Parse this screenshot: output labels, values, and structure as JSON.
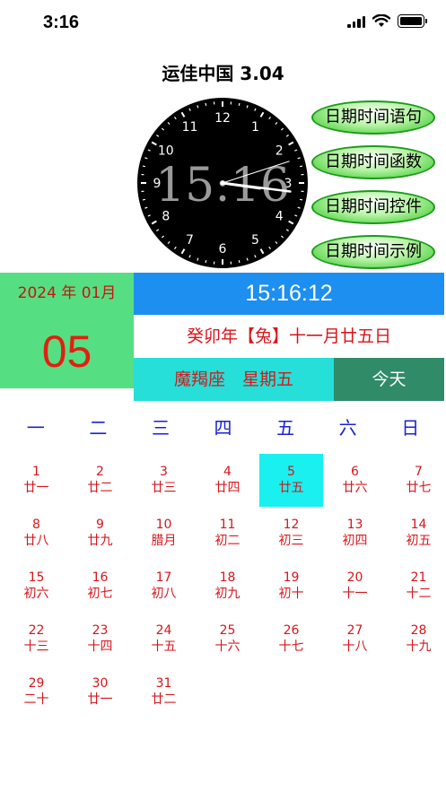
{
  "status_bar": {
    "time": "3:16"
  },
  "app": {
    "title": "运佳中国 3.04"
  },
  "clock": {
    "digital": "15:16",
    "numbers": [
      "12",
      "1",
      "2",
      "3",
      "4",
      "5",
      "6",
      "7",
      "8",
      "9",
      "10",
      "11"
    ],
    "hour": 15,
    "minute": 16,
    "second": 12
  },
  "menu": {
    "sentence": "日期时间语句",
    "functions": "日期时间函数",
    "controls": "日期时间控件",
    "examples": "日期时间示例"
  },
  "panel": {
    "year_month": "2024 年 01月",
    "day": "05",
    "time": "15:16:12",
    "lunar": "癸卯年【兔】十一月廿五日",
    "zodiac_weekday": "魔羯座　星期五",
    "today": "今天"
  },
  "weekdays": [
    "一",
    "二",
    "三",
    "四",
    "五",
    "六",
    "日"
  ],
  "calendar": [
    [
      {
        "d": "1",
        "l": "廿一"
      },
      {
        "d": "2",
        "l": "廿二"
      },
      {
        "d": "3",
        "l": "廿三"
      },
      {
        "d": "4",
        "l": "廿四"
      },
      {
        "d": "5",
        "l": "廿五",
        "selected": true
      },
      {
        "d": "6",
        "l": "廿六"
      },
      {
        "d": "7",
        "l": "廿七"
      }
    ],
    [
      {
        "d": "8",
        "l": "廿八"
      },
      {
        "d": "9",
        "l": "廿九"
      },
      {
        "d": "10",
        "l": "腊月"
      },
      {
        "d": "11",
        "l": "初二"
      },
      {
        "d": "12",
        "l": "初三"
      },
      {
        "d": "13",
        "l": "初四"
      },
      {
        "d": "14",
        "l": "初五"
      }
    ],
    [
      {
        "d": "15",
        "l": "初六"
      },
      {
        "d": "16",
        "l": "初七"
      },
      {
        "d": "17",
        "l": "初八"
      },
      {
        "d": "18",
        "l": "初九"
      },
      {
        "d": "19",
        "l": "初十"
      },
      {
        "d": "20",
        "l": "十一"
      },
      {
        "d": "21",
        "l": "十二"
      }
    ],
    [
      {
        "d": "22",
        "l": "十三"
      },
      {
        "d": "23",
        "l": "十四"
      },
      {
        "d": "24",
        "l": "十五"
      },
      {
        "d": "25",
        "l": "十六"
      },
      {
        "d": "26",
        "l": "十七"
      },
      {
        "d": "27",
        "l": "十八"
      },
      {
        "d": "28",
        "l": "十九"
      }
    ],
    [
      {
        "d": "29",
        "l": "二十"
      },
      {
        "d": "30",
        "l": "廿一"
      },
      {
        "d": "31",
        "l": "廿二"
      }
    ]
  ],
  "colors": {
    "green_panel": "#56de83",
    "time_bar": "#1d8ff0",
    "zodiac_bar": "#25dfd8",
    "today_button": "#2f8b68",
    "selected_cell": "#19f0ef",
    "calendar_text": "#d8151c",
    "weekday_text": "#1a22d0"
  }
}
